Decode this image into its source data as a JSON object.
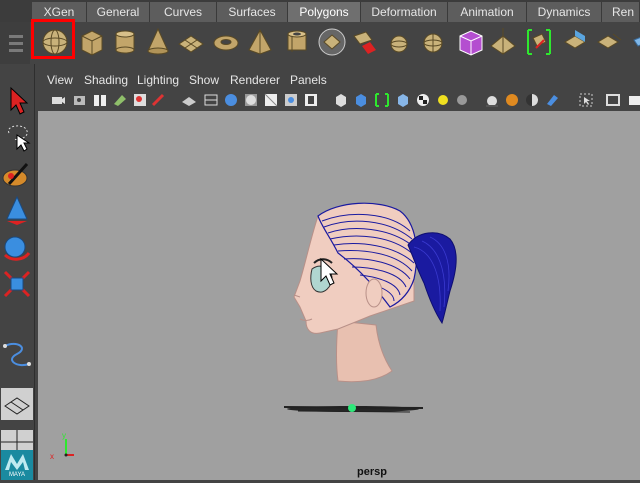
{
  "shelf_tabs": [
    {
      "label": "XGen"
    },
    {
      "label": "General"
    },
    {
      "label": "Curves"
    },
    {
      "label": "Surfaces"
    },
    {
      "label": "Polygons"
    },
    {
      "label": "Deformation"
    },
    {
      "label": "Animation"
    },
    {
      "label": "Dynamics"
    },
    {
      "label": "Ren"
    }
  ],
  "active_tab": "Polygons",
  "panel_menu": [
    "View",
    "Shading",
    "Lighting",
    "Show",
    "Renderer",
    "Panels"
  ],
  "viewport": {
    "camera_label": "persp",
    "background": "#a0a0a0"
  },
  "highlight_color": "#ff0000",
  "toolbox_logo": "MAYA",
  "shelf_icons": [
    "poly-sphere-icon",
    "poly-cube-icon",
    "poly-cylinder-icon",
    "poly-cone-icon",
    "poly-plane-icon",
    "poly-torus-icon",
    "poly-pyramid-icon",
    "poly-pipe-icon",
    "create-polygon-icon",
    "append-polygon-icon",
    "combine-icon",
    "separate-icon",
    "boolean-icon",
    "mirror-icon",
    "split-icon",
    "extrude-icon",
    "bridge-icon",
    "smooth-icon"
  ]
}
